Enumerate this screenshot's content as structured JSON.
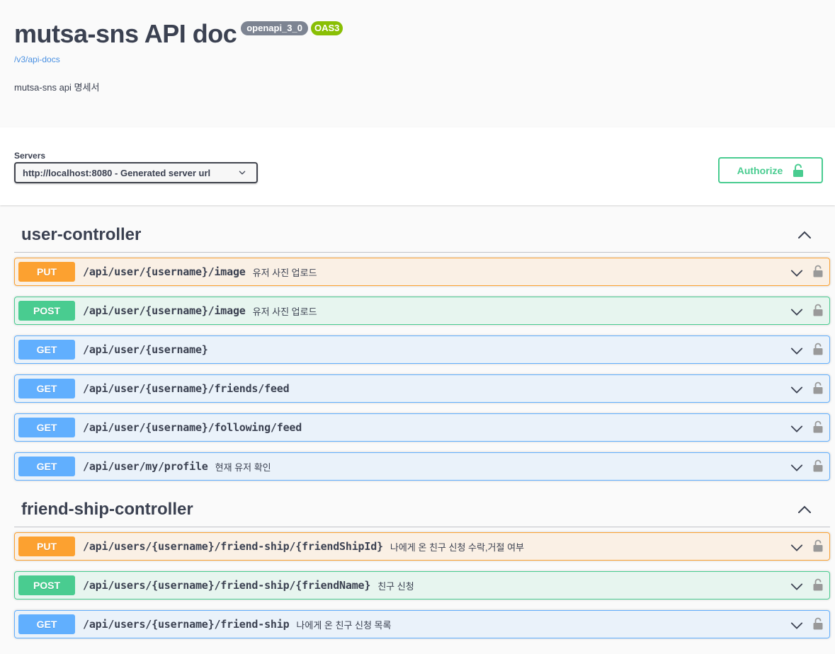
{
  "info": {
    "title": "mutsa-sns API doc",
    "version_badge": "openapi_3_0",
    "oas_badge": "OAS3",
    "api_link": "/v3/api-docs",
    "description": "mutsa-sns api 명세서"
  },
  "servers": {
    "label": "Servers",
    "selected": "http://localhost:8080 - Generated server url"
  },
  "authorize": {
    "label": "Authorize"
  },
  "tags": [
    {
      "name": "user-controller",
      "operations": [
        {
          "method": "PUT",
          "path": "/api/user/{username}/image",
          "summary": "유저 사진 업로드"
        },
        {
          "method": "POST",
          "path": "/api/user/{username}/image",
          "summary": "유저 사진 업로드"
        },
        {
          "method": "GET",
          "path": "/api/user/{username}",
          "summary": ""
        },
        {
          "method": "GET",
          "path": "/api/user/{username}/friends/feed",
          "summary": ""
        },
        {
          "method": "GET",
          "path": "/api/user/{username}/following/feed",
          "summary": ""
        },
        {
          "method": "GET",
          "path": "/api/user/my/profile",
          "summary": "현재 유저 확인"
        }
      ]
    },
    {
      "name": "friend-ship-controller",
      "operations": [
        {
          "method": "PUT",
          "path": "/api/users/{username}/friend-ship/{friendShipId}",
          "summary": "나에게 온 친구 신청 수락,거절 여부"
        },
        {
          "method": "POST",
          "path": "/api/users/{username}/friend-ship/{friendName}",
          "summary": "친구 신청"
        },
        {
          "method": "GET",
          "path": "/api/users/{username}/friend-ship",
          "summary": "나에게 온 친구 신청 목록"
        }
      ]
    }
  ],
  "colors": {
    "put": "#fca130",
    "post": "#49cc90",
    "get": "#61affe",
    "authorize": "#49cc90",
    "oas_badge": "#89bf04",
    "version_badge": "#7d8492"
  },
  "icons": {
    "tag_toggle": "chevron-up-icon",
    "operation_toggle": "chevron-down-icon",
    "operation_auth": "lock-icon",
    "authorize": "lock-open-icon",
    "server_select": "chevron-down-icon"
  }
}
